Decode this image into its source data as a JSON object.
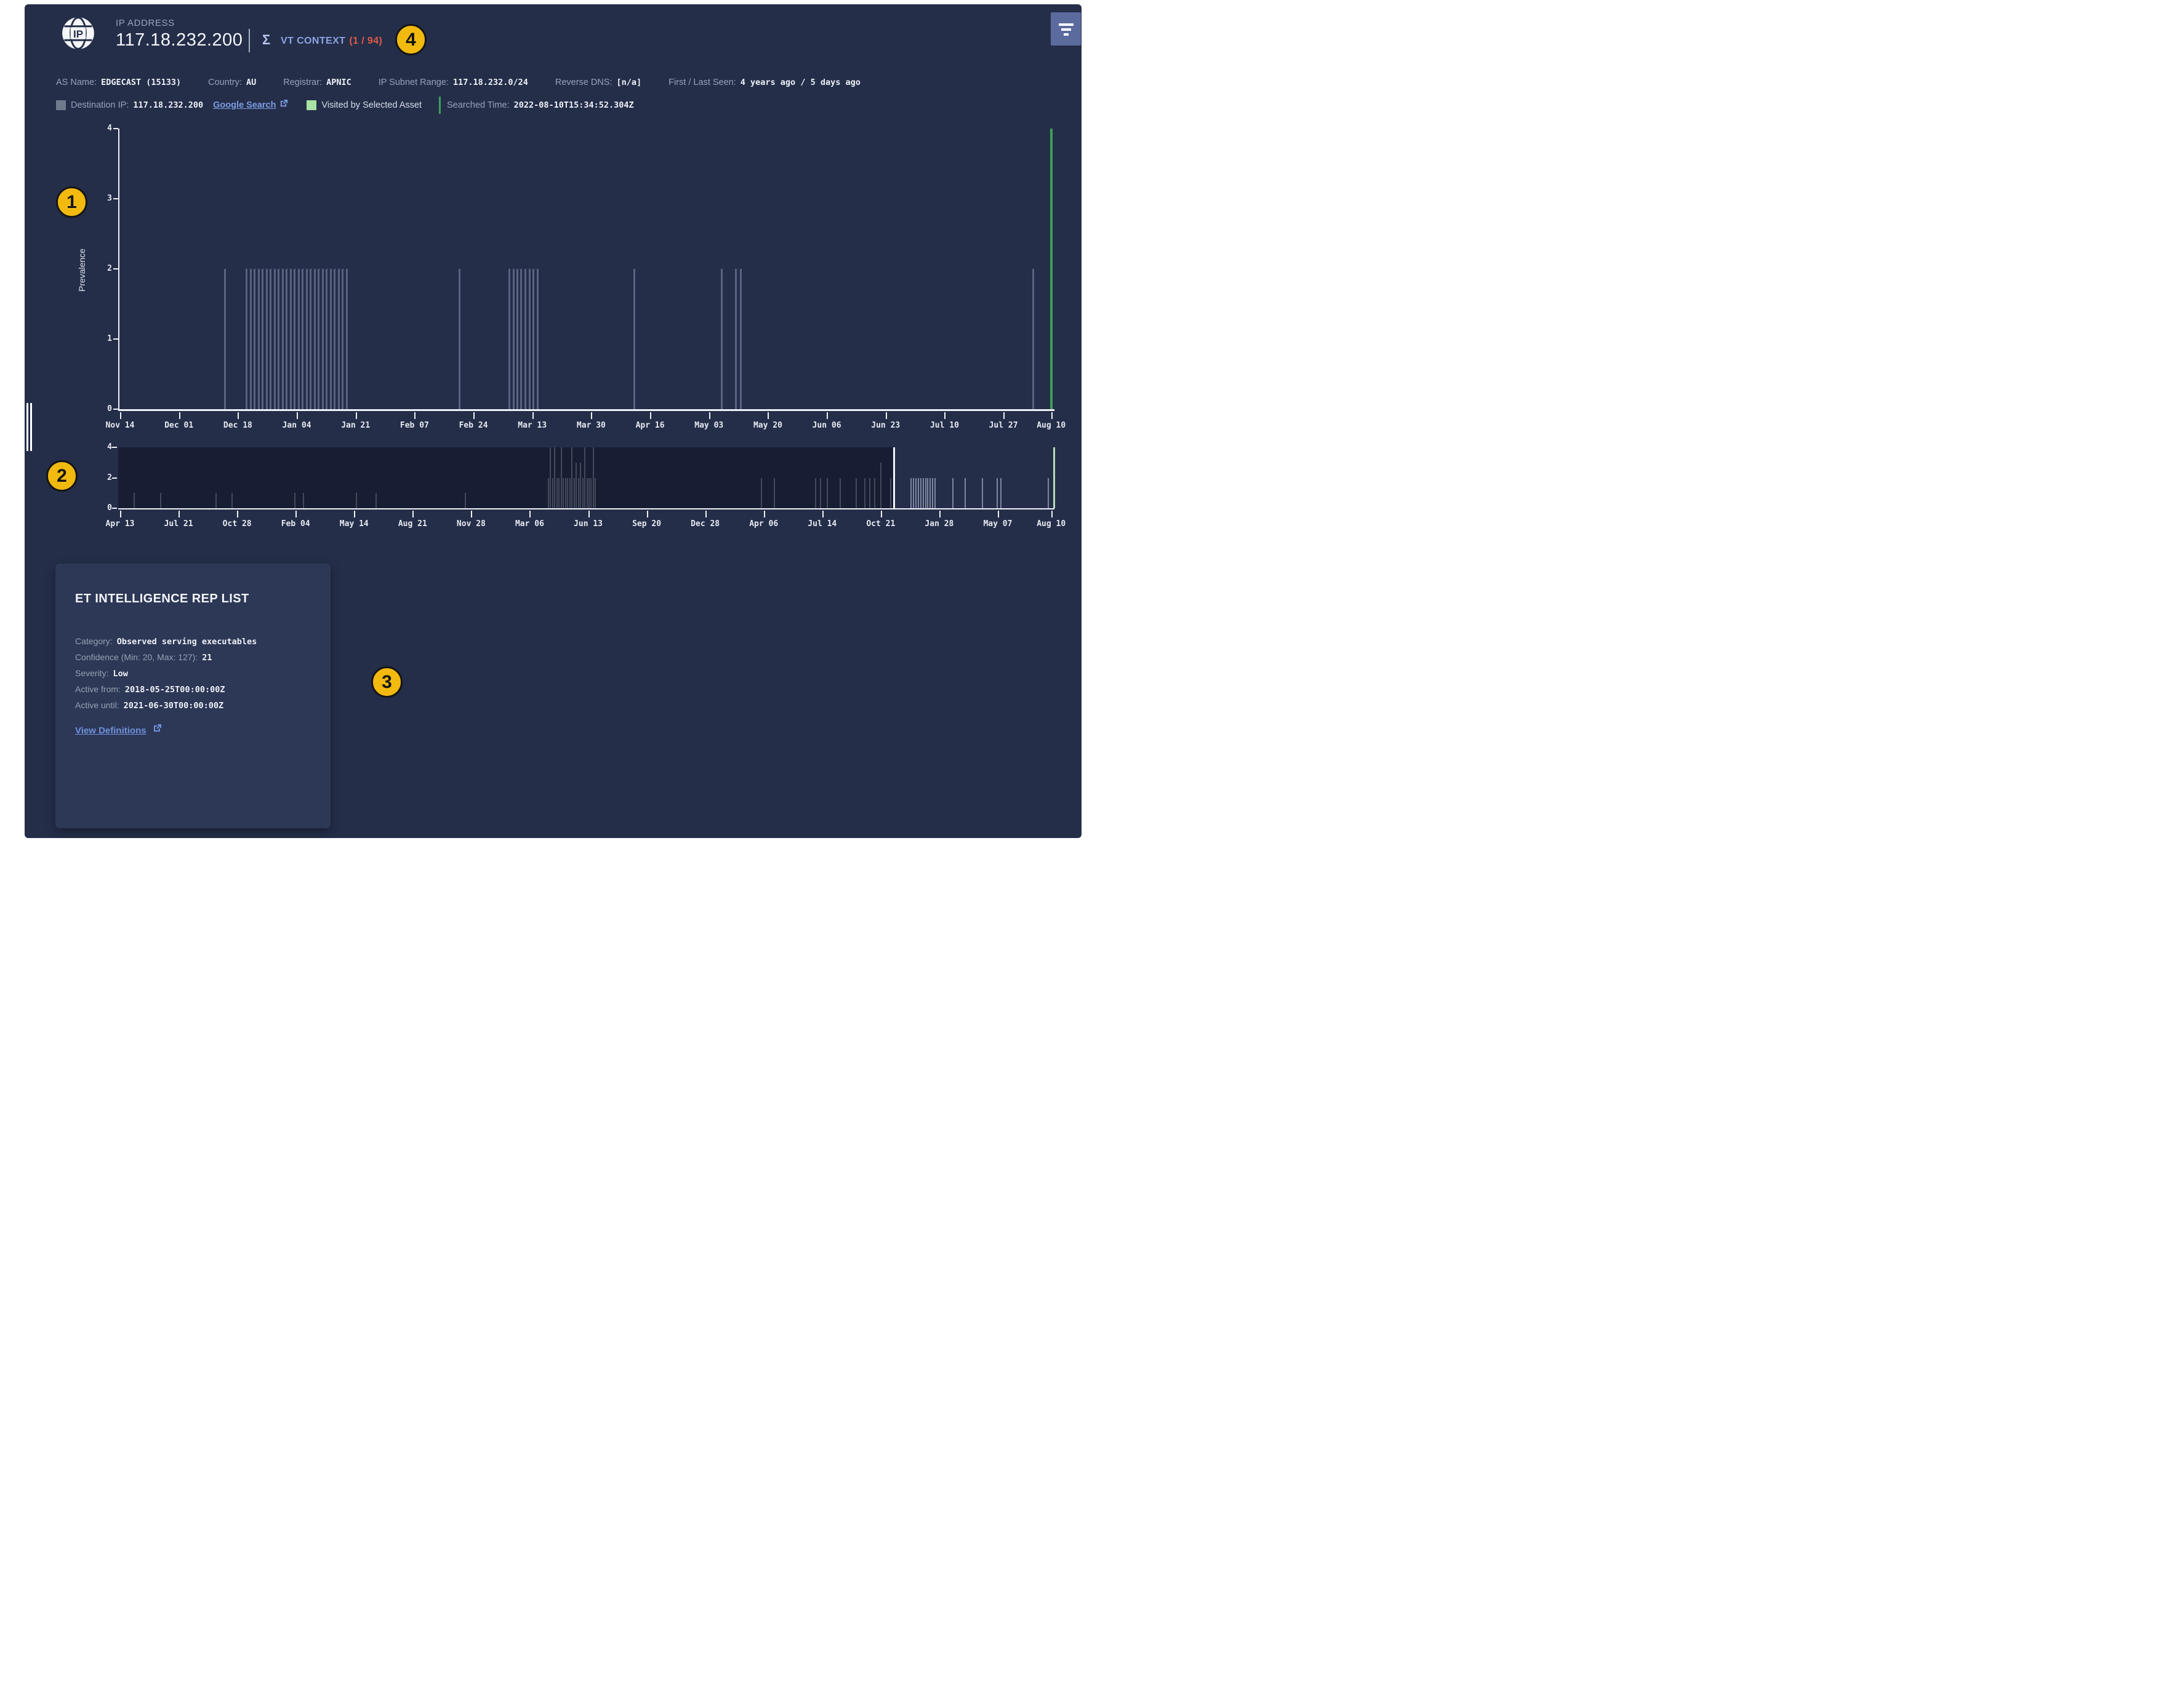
{
  "header": {
    "icon_text": "IP",
    "entity_label": "IP ADDRESS",
    "ip_address": "117.18.232.200",
    "vt_context_label": "VT CONTEXT",
    "vt_context_count": "(1 / 94)"
  },
  "meta": {
    "items": [
      {
        "label": "AS Name:",
        "value": "EDGECAST (15133)"
      },
      {
        "label": "Country:",
        "value": "AU"
      },
      {
        "label": "Registrar:",
        "value": "APNIC"
      },
      {
        "label": "IP Subnet Range:",
        "value": "117.18.232.0/24"
      },
      {
        "label": "Reverse DNS:",
        "value": "[n/a]"
      },
      {
        "label": "First / Last Seen:",
        "value": "4 years ago / 5 days ago"
      }
    ]
  },
  "legend": {
    "destination_label": "Destination IP:",
    "destination_value": "117.18.232.200",
    "google_search": "Google Search",
    "visited_label": "Visited by Selected Asset",
    "searched_label": "Searched Time:",
    "searched_value": "2022-08-10T15:34:52.304Z",
    "colors": {
      "destination_swatch": "#71798d",
      "visited_swatch": "#a8e2a4",
      "searched_line": "#3da05c"
    }
  },
  "chart_data": [
    {
      "type": "bar",
      "title": "Prevalence over selected window",
      "ylabel": "Prevalence",
      "ylim": [
        0,
        4
      ],
      "yticks": [
        0,
        1,
        2,
        3,
        4
      ],
      "grid": false,
      "bar_color": "#59637f",
      "highlight_color": "#3f9e55",
      "xticks": [
        {
          "label": "Nov 14",
          "f": 0.002
        },
        {
          "label": "Dec 01",
          "f": 0.0649
        },
        {
          "label": "Dec 18",
          "f": 0.1278
        },
        {
          "label": "Jan 04",
          "f": 0.1907
        },
        {
          "label": "Jan 21",
          "f": 0.2536
        },
        {
          "label": "Feb 07",
          "f": 0.3165
        },
        {
          "label": "Feb 24",
          "f": 0.3794
        },
        {
          "label": "Mar 13",
          "f": 0.4423
        },
        {
          "label": "Mar 30",
          "f": 0.5052
        },
        {
          "label": "Apr 16",
          "f": 0.5681
        },
        {
          "label": "May 03",
          "f": 0.631
        },
        {
          "label": "May 20",
          "f": 0.6939
        },
        {
          "label": "Jun 06",
          "f": 0.7568
        },
        {
          "label": "Jun 23",
          "f": 0.8197
        },
        {
          "label": "Jul 10",
          "f": 0.8826
        },
        {
          "label": "Jul 27",
          "f": 0.9455
        },
        {
          "label": "Aug 10",
          "f": 0.9965
        }
      ],
      "bars": [
        {
          "f": 0.112,
          "v": 2
        },
        {
          "f": 0.135,
          "v": 2
        },
        {
          "f": 0.1393,
          "v": 2
        },
        {
          "f": 0.1436,
          "v": 2
        },
        {
          "f": 0.1478,
          "v": 2
        },
        {
          "f": 0.1521,
          "v": 2
        },
        {
          "f": 0.1564,
          "v": 2
        },
        {
          "f": 0.1607,
          "v": 2
        },
        {
          "f": 0.165,
          "v": 2
        },
        {
          "f": 0.1693,
          "v": 2
        },
        {
          "f": 0.1735,
          "v": 2
        },
        {
          "f": 0.1778,
          "v": 2
        },
        {
          "f": 0.1821,
          "v": 2
        },
        {
          "f": 0.1864,
          "v": 2
        },
        {
          "f": 0.1907,
          "v": 2
        },
        {
          "f": 0.195,
          "v": 2
        },
        {
          "f": 0.1992,
          "v": 2
        },
        {
          "f": 0.2035,
          "v": 2
        },
        {
          "f": 0.2078,
          "v": 2
        },
        {
          "f": 0.2121,
          "v": 2
        },
        {
          "f": 0.2164,
          "v": 2
        },
        {
          "f": 0.2207,
          "v": 2
        },
        {
          "f": 0.2249,
          "v": 2
        },
        {
          "f": 0.2292,
          "v": 2
        },
        {
          "f": 0.2335,
          "v": 2
        },
        {
          "f": 0.2378,
          "v": 2
        },
        {
          "f": 0.2421,
          "v": 2
        },
        {
          "f": 0.363,
          "v": 2
        },
        {
          "f": 0.4161,
          "v": 2
        },
        {
          "f": 0.4204,
          "v": 2
        },
        {
          "f": 0.4247,
          "v": 2
        },
        {
          "f": 0.4289,
          "v": 2
        },
        {
          "f": 0.4332,
          "v": 2
        },
        {
          "f": 0.4375,
          "v": 2
        },
        {
          "f": 0.4418,
          "v": 2
        },
        {
          "f": 0.4461,
          "v": 2
        },
        {
          "f": 0.55,
          "v": 2
        },
        {
          "f": 0.6434,
          "v": 2
        },
        {
          "f": 0.6586,
          "v": 2
        },
        {
          "f": 0.6635,
          "v": 2
        },
        {
          "f": 0.976,
          "v": 2
        },
        {
          "f": 0.9953,
          "v": 4,
          "highlight": true
        }
      ]
    },
    {
      "type": "bar",
      "title": "Full history overview with brush window",
      "ylabel": "",
      "ylim": [
        0,
        4
      ],
      "yticks": [
        0,
        2,
        4
      ],
      "grid": false,
      "bar_color": "#7d869e",
      "window": {
        "start_f": 0.828,
        "end_f": 0.9985,
        "start_handle_color": "#f2f5f8",
        "end_handle_color": "#b7ddb4"
      },
      "xticks": [
        {
          "label": "Apr 13",
          "f": 0.002
        },
        {
          "label": "Jul 21",
          "f": 0.0645
        },
        {
          "label": "Oct 28",
          "f": 0.127
        },
        {
          "label": "Feb 04",
          "f": 0.1895
        },
        {
          "label": "May 14",
          "f": 0.252
        },
        {
          "label": "Aug 21",
          "f": 0.3145
        },
        {
          "label": "Nov 28",
          "f": 0.377
        },
        {
          "label": "Mar 06",
          "f": 0.4395
        },
        {
          "label": "Jun 13",
          "f": 0.502
        },
        {
          "label": "Sep 20",
          "f": 0.5645
        },
        {
          "label": "Dec 28",
          "f": 0.627
        },
        {
          "label": "Apr 06",
          "f": 0.6895
        },
        {
          "label": "Jul 14",
          "f": 0.752
        },
        {
          "label": "Oct 21",
          "f": 0.8145
        },
        {
          "label": "Jan 28",
          "f": 0.877
        },
        {
          "label": "May 07",
          "f": 0.9395
        },
        {
          "label": "Aug 10",
          "f": 0.9965
        }
      ],
      "bars": [
        {
          "f": 0.0164,
          "v": 1
        },
        {
          "f": 0.0447,
          "v": 1
        },
        {
          "f": 0.1036,
          "v": 1
        },
        {
          "f": 0.1207,
          "v": 1
        },
        {
          "f": 0.1882,
          "v": 1
        },
        {
          "f": 0.197,
          "v": 1
        },
        {
          "f": 0.2539,
          "v": 1
        },
        {
          "f": 0.2747,
          "v": 1
        },
        {
          "f": 0.3701,
          "v": 1
        },
        {
          "f": 0.4586,
          "v": 2
        },
        {
          "f": 0.4609,
          "v": 4
        },
        {
          "f": 0.4632,
          "v": 2
        },
        {
          "f": 0.4655,
          "v": 4
        },
        {
          "f": 0.4678,
          "v": 2
        },
        {
          "f": 0.4701,
          "v": 2
        },
        {
          "f": 0.4724,
          "v": 4
        },
        {
          "f": 0.4747,
          "v": 2
        },
        {
          "f": 0.477,
          "v": 2
        },
        {
          "f": 0.4793,
          "v": 2
        },
        {
          "f": 0.4816,
          "v": 2
        },
        {
          "f": 0.4839,
          "v": 4
        },
        {
          "f": 0.4862,
          "v": 2
        },
        {
          "f": 0.4885,
          "v": 3
        },
        {
          "f": 0.4908,
          "v": 2
        },
        {
          "f": 0.4931,
          "v": 3
        },
        {
          "f": 0.4954,
          "v": 2
        },
        {
          "f": 0.4977,
          "v": 4
        },
        {
          "f": 0.5,
          "v": 2
        },
        {
          "f": 0.5023,
          "v": 2
        },
        {
          "f": 0.5046,
          "v": 2
        },
        {
          "f": 0.5069,
          "v": 4
        },
        {
          "f": 0.5092,
          "v": 2
        },
        {
          "f": 0.6862,
          "v": 2
        },
        {
          "f": 0.7,
          "v": 2
        },
        {
          "f": 0.7441,
          "v": 2
        },
        {
          "f": 0.7493,
          "v": 2
        },
        {
          "f": 0.7566,
          "v": 2
        },
        {
          "f": 0.7704,
          "v": 2
        },
        {
          "f": 0.7878,
          "v": 2
        },
        {
          "f": 0.7967,
          "v": 2
        },
        {
          "f": 0.802,
          "v": 2
        },
        {
          "f": 0.8072,
          "v": 2
        },
        {
          "f": 0.8141,
          "v": 3
        },
        {
          "f": 0.8247,
          "v": 2
        },
        {
          "f": 0.8464,
          "v": 2
        },
        {
          "f": 0.849,
          "v": 2
        },
        {
          "f": 0.8515,
          "v": 2
        },
        {
          "f": 0.8541,
          "v": 2
        },
        {
          "f": 0.8566,
          "v": 2
        },
        {
          "f": 0.8591,
          "v": 2
        },
        {
          "f": 0.8617,
          "v": 2
        },
        {
          "f": 0.8642,
          "v": 2
        },
        {
          "f": 0.8667,
          "v": 2
        },
        {
          "f": 0.8693,
          "v": 2
        },
        {
          "f": 0.8718,
          "v": 2
        },
        {
          "f": 0.8908,
          "v": 2
        },
        {
          "f": 0.9043,
          "v": 2
        },
        {
          "f": 0.9224,
          "v": 2
        },
        {
          "f": 0.9385,
          "v": 2
        },
        {
          "f": 0.9421,
          "v": 2
        },
        {
          "f": 0.9928,
          "v": 2
        }
      ]
    }
  ],
  "card": {
    "title": "ET INTELLIGENCE REP LIST",
    "fields": [
      {
        "label": "Category:",
        "value": "Observed serving executables"
      },
      {
        "label": "Confidence (Min: 20, Max: 127):",
        "value": "21"
      },
      {
        "label": "Severity:",
        "value": "Low"
      },
      {
        "label": "Active from:",
        "value": "2018-05-25T00:00:00Z"
      },
      {
        "label": "Active until:",
        "value": "2021-06-30T00:00:00Z"
      }
    ],
    "link_label": "View Definitions"
  },
  "annotations": {
    "markers": [
      "1",
      "2",
      "3",
      "4"
    ]
  },
  "colors": {
    "page_margin": "#ffffff",
    "panel_bg": "#242e49",
    "card_bg": "#2d3756",
    "accent_blue": "#8ba3e2",
    "alert_red": "#e05a48",
    "link_blue": "#7d9ce4",
    "highlight_green": "#3f9e55",
    "annotation_yellow": "#f2ba0f",
    "filter_button_bg": "#5c6b9d"
  }
}
